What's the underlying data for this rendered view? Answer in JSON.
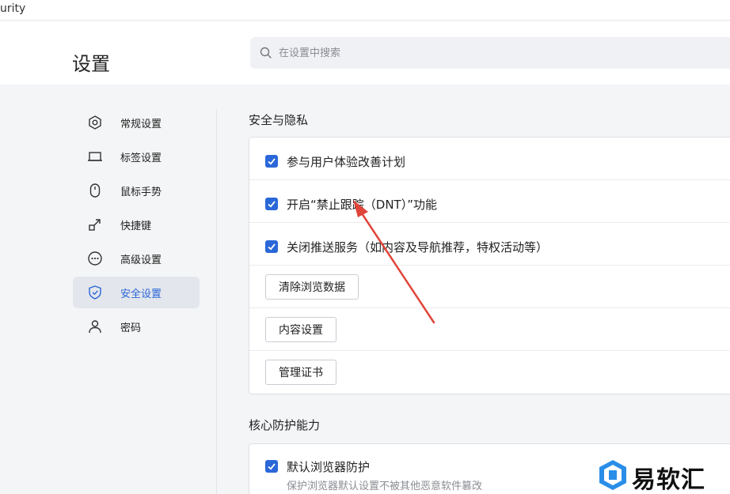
{
  "window": {
    "tab_title": "urity"
  },
  "header": {
    "title": "设置",
    "search_placeholder": "在设置中搜索"
  },
  "sidebar": {
    "items": [
      {
        "label": "常规设置",
        "icon": "hexagon-icon",
        "active": false
      },
      {
        "label": "标签设置",
        "icon": "tab-icon",
        "active": false
      },
      {
        "label": "鼠标手势",
        "icon": "mouse-icon",
        "active": false
      },
      {
        "label": "快捷键",
        "icon": "shortcut-arrow-icon",
        "active": false
      },
      {
        "label": "高级设置",
        "icon": "more-circle-icon",
        "active": false
      },
      {
        "label": "安全设置",
        "icon": "shield-icon",
        "active": true
      },
      {
        "label": "密码",
        "icon": "user-icon",
        "active": false
      }
    ]
  },
  "security": {
    "title": "安全与隐私",
    "options": [
      {
        "label": "参与用户体验改善计划",
        "checked": true
      },
      {
        "label": "开启“禁止跟踪（DNT）”功能",
        "checked": true
      },
      {
        "label": "关闭推送服务（如内容及导航推荐，特权活动等）",
        "checked": true
      }
    ],
    "buttons": [
      "清除浏览数据",
      "内容设置",
      "管理证书"
    ]
  },
  "core": {
    "title": "核心防护能力",
    "options": [
      {
        "label": "默认浏览器防护",
        "checked": true,
        "description": "保护浏览器默认设置不被其他恶意软件篡改"
      }
    ]
  },
  "annotation": {
    "color": "#e0453a"
  },
  "watermark": {
    "text": "易软汇",
    "color": "#2a8ee8"
  },
  "colors": {
    "accent": "#2a67d8",
    "active_bg": "#e3e6ec"
  }
}
